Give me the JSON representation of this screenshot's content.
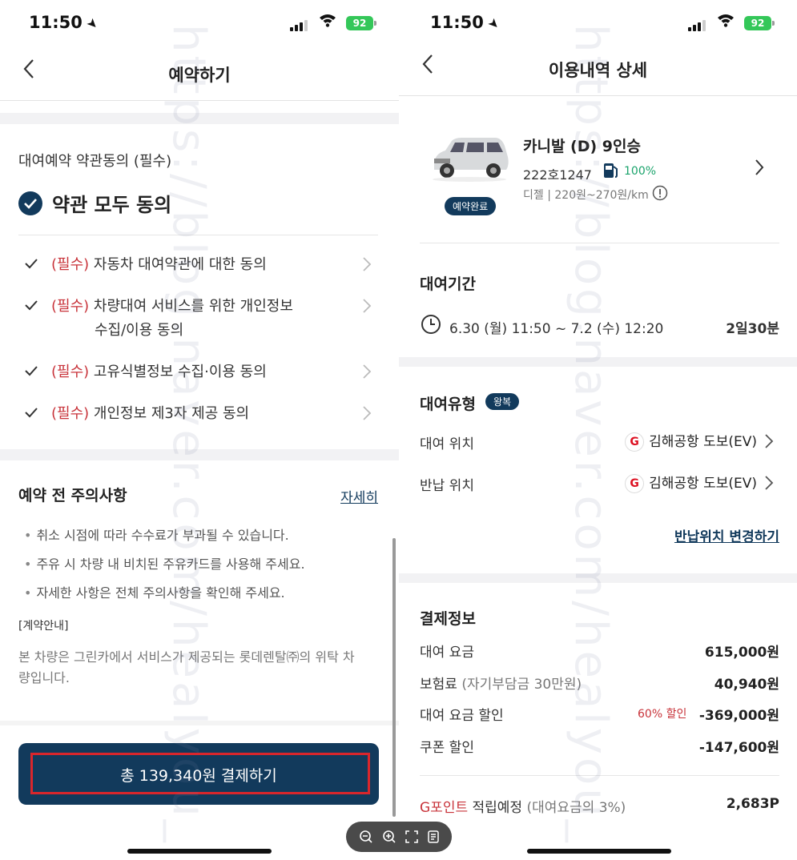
{
  "status_bar": {
    "time": "11:50",
    "battery": "92"
  },
  "left": {
    "title": "예약하기",
    "terms_heading": "대여예약 약관동의 (필수)",
    "agree_all": "약관 모두 동의",
    "terms": [
      {
        "tag": "(필수)",
        "text": "자동차 대여약관에 대한 동의"
      },
      {
        "tag": "(필수)",
        "text": "차량대여 서비스를 위한 개인정보",
        "text2": "수집/이용 동의"
      },
      {
        "tag": "(필수)",
        "text": "고유식별정보 수집·이용 동의"
      },
      {
        "tag": "(필수)",
        "text": "개인정보 제3자 제공 동의"
      }
    ],
    "notice_heading": "예약 전 주의사항",
    "notice_link": "자세히",
    "notices": [
      "취소 시점에 따라 수수료가 부과될 수 있습니다.",
      "주유 시 차량 내 비치된 주유카드를 사용해 주세요.",
      "자세한 사항은 전체 주의사항을 확인해 주세요."
    ],
    "contract_label": "[계약안내]",
    "contract_text1": "본 차량은 그린카에서 서비스가 제공되는 롯데렌탈㈜의 위탁 차",
    "contract_text2": "량입니다.",
    "pay_button": "총 139,340원 결제하기"
  },
  "right": {
    "title": "이용내역 상세",
    "car_name": "카니발 (D) 9인승",
    "plate": "222호1247",
    "fuel_level": "100%",
    "fuel_info": "디젤 | 220원~270원/km",
    "status_badge": "예약완료",
    "period_heading": "대여기간",
    "period": "6.30 (월) 11:50 ~ 7.2 (수) 12:20",
    "duration": "2일30분",
    "type_heading": "대여유형",
    "type_badge": "왕복",
    "pickup_label": "대여 위치",
    "pickup_value": "김해공항 도보(EV)",
    "return_label": "반납 위치",
    "return_value": "김해공항 도보(EV)",
    "g_icon": "G",
    "change_return": "반납위치 변경하기",
    "payment_heading": "결제정보",
    "rental_fee_label": "대여 요금",
    "rental_fee": "615,000원",
    "insurance_label": "보험료",
    "insurance_note": "(자기부담금 30만원)",
    "insurance": "40,940원",
    "discount_label": "대여 요금 할인",
    "discount_rate": "60% 할인",
    "discount": "-369,000원",
    "coupon_label": "쿠폰 할인",
    "coupon": "-147,600원",
    "gpoint_label_red": "G포인트",
    "gpoint_label": "적립예정",
    "gpoint_note": "(대여요금의 3%)",
    "gpoint": "2,683P"
  },
  "watermark": "https://blog.naver.com/healyou_",
  "colors": {
    "navy": "#123a5c",
    "required_red": "#c8333a",
    "green": "#1aa36b",
    "highlight_box": "#d9262c"
  },
  "icons": [
    "location-arrow-icon",
    "signal-icon",
    "wifi-icon",
    "battery-icon",
    "back-chevron-icon",
    "check-circle-icon",
    "check-icon",
    "chevron-right-icon",
    "car-image",
    "fuel-pump-icon",
    "info-icon",
    "clock-icon",
    "zoom-out-icon",
    "zoom-in-icon",
    "fullscreen-icon",
    "document-icon"
  ]
}
